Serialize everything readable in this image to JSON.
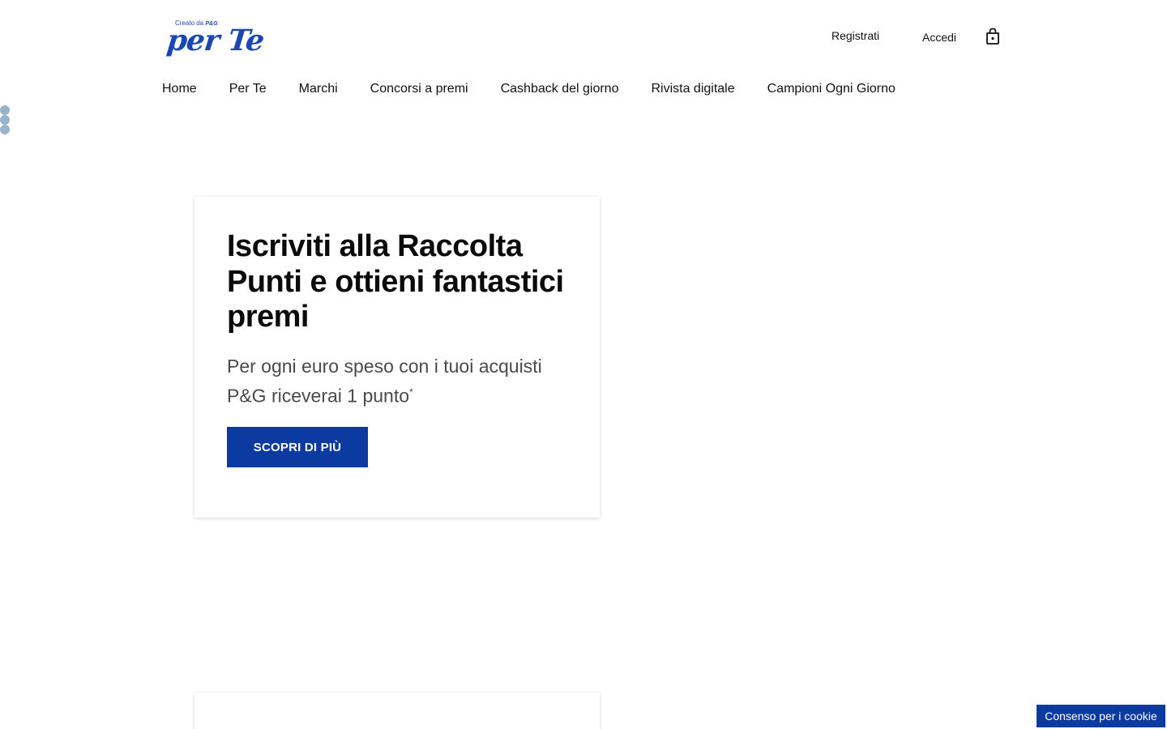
{
  "header": {
    "logo": {
      "tagline": "Creato da",
      "tagline_brand": "P&G",
      "wordmark": "per Te"
    },
    "links": {
      "register": "Registrati",
      "login": "Accedi"
    },
    "cart_icon": "shopping-bag-icon"
  },
  "nav": {
    "items": [
      {
        "label": "Home"
      },
      {
        "label": "Per Te"
      },
      {
        "label": "Marchi"
      },
      {
        "label": "Concorsi a premi"
      },
      {
        "label": "Cashback del giorno"
      },
      {
        "label": "Rivista digitale"
      },
      {
        "label": "Campioni Ogni Giorno"
      }
    ]
  },
  "promo": {
    "title": "Iscriviti alla Raccolta Punti e ottieni fantastici premi",
    "description": "Per ogni euro speso con i tuoi acquisti P&G riceverai 1 punto",
    "description_footnote": "*",
    "cta_label": "SCOPRI DI PIÙ"
  },
  "cookie": {
    "label": "Consenso per i cookie"
  },
  "colors": {
    "brand_blue": "#0b3aa0",
    "logo_blue": "#1b47b3",
    "dot_color": "#9ab3cc"
  }
}
